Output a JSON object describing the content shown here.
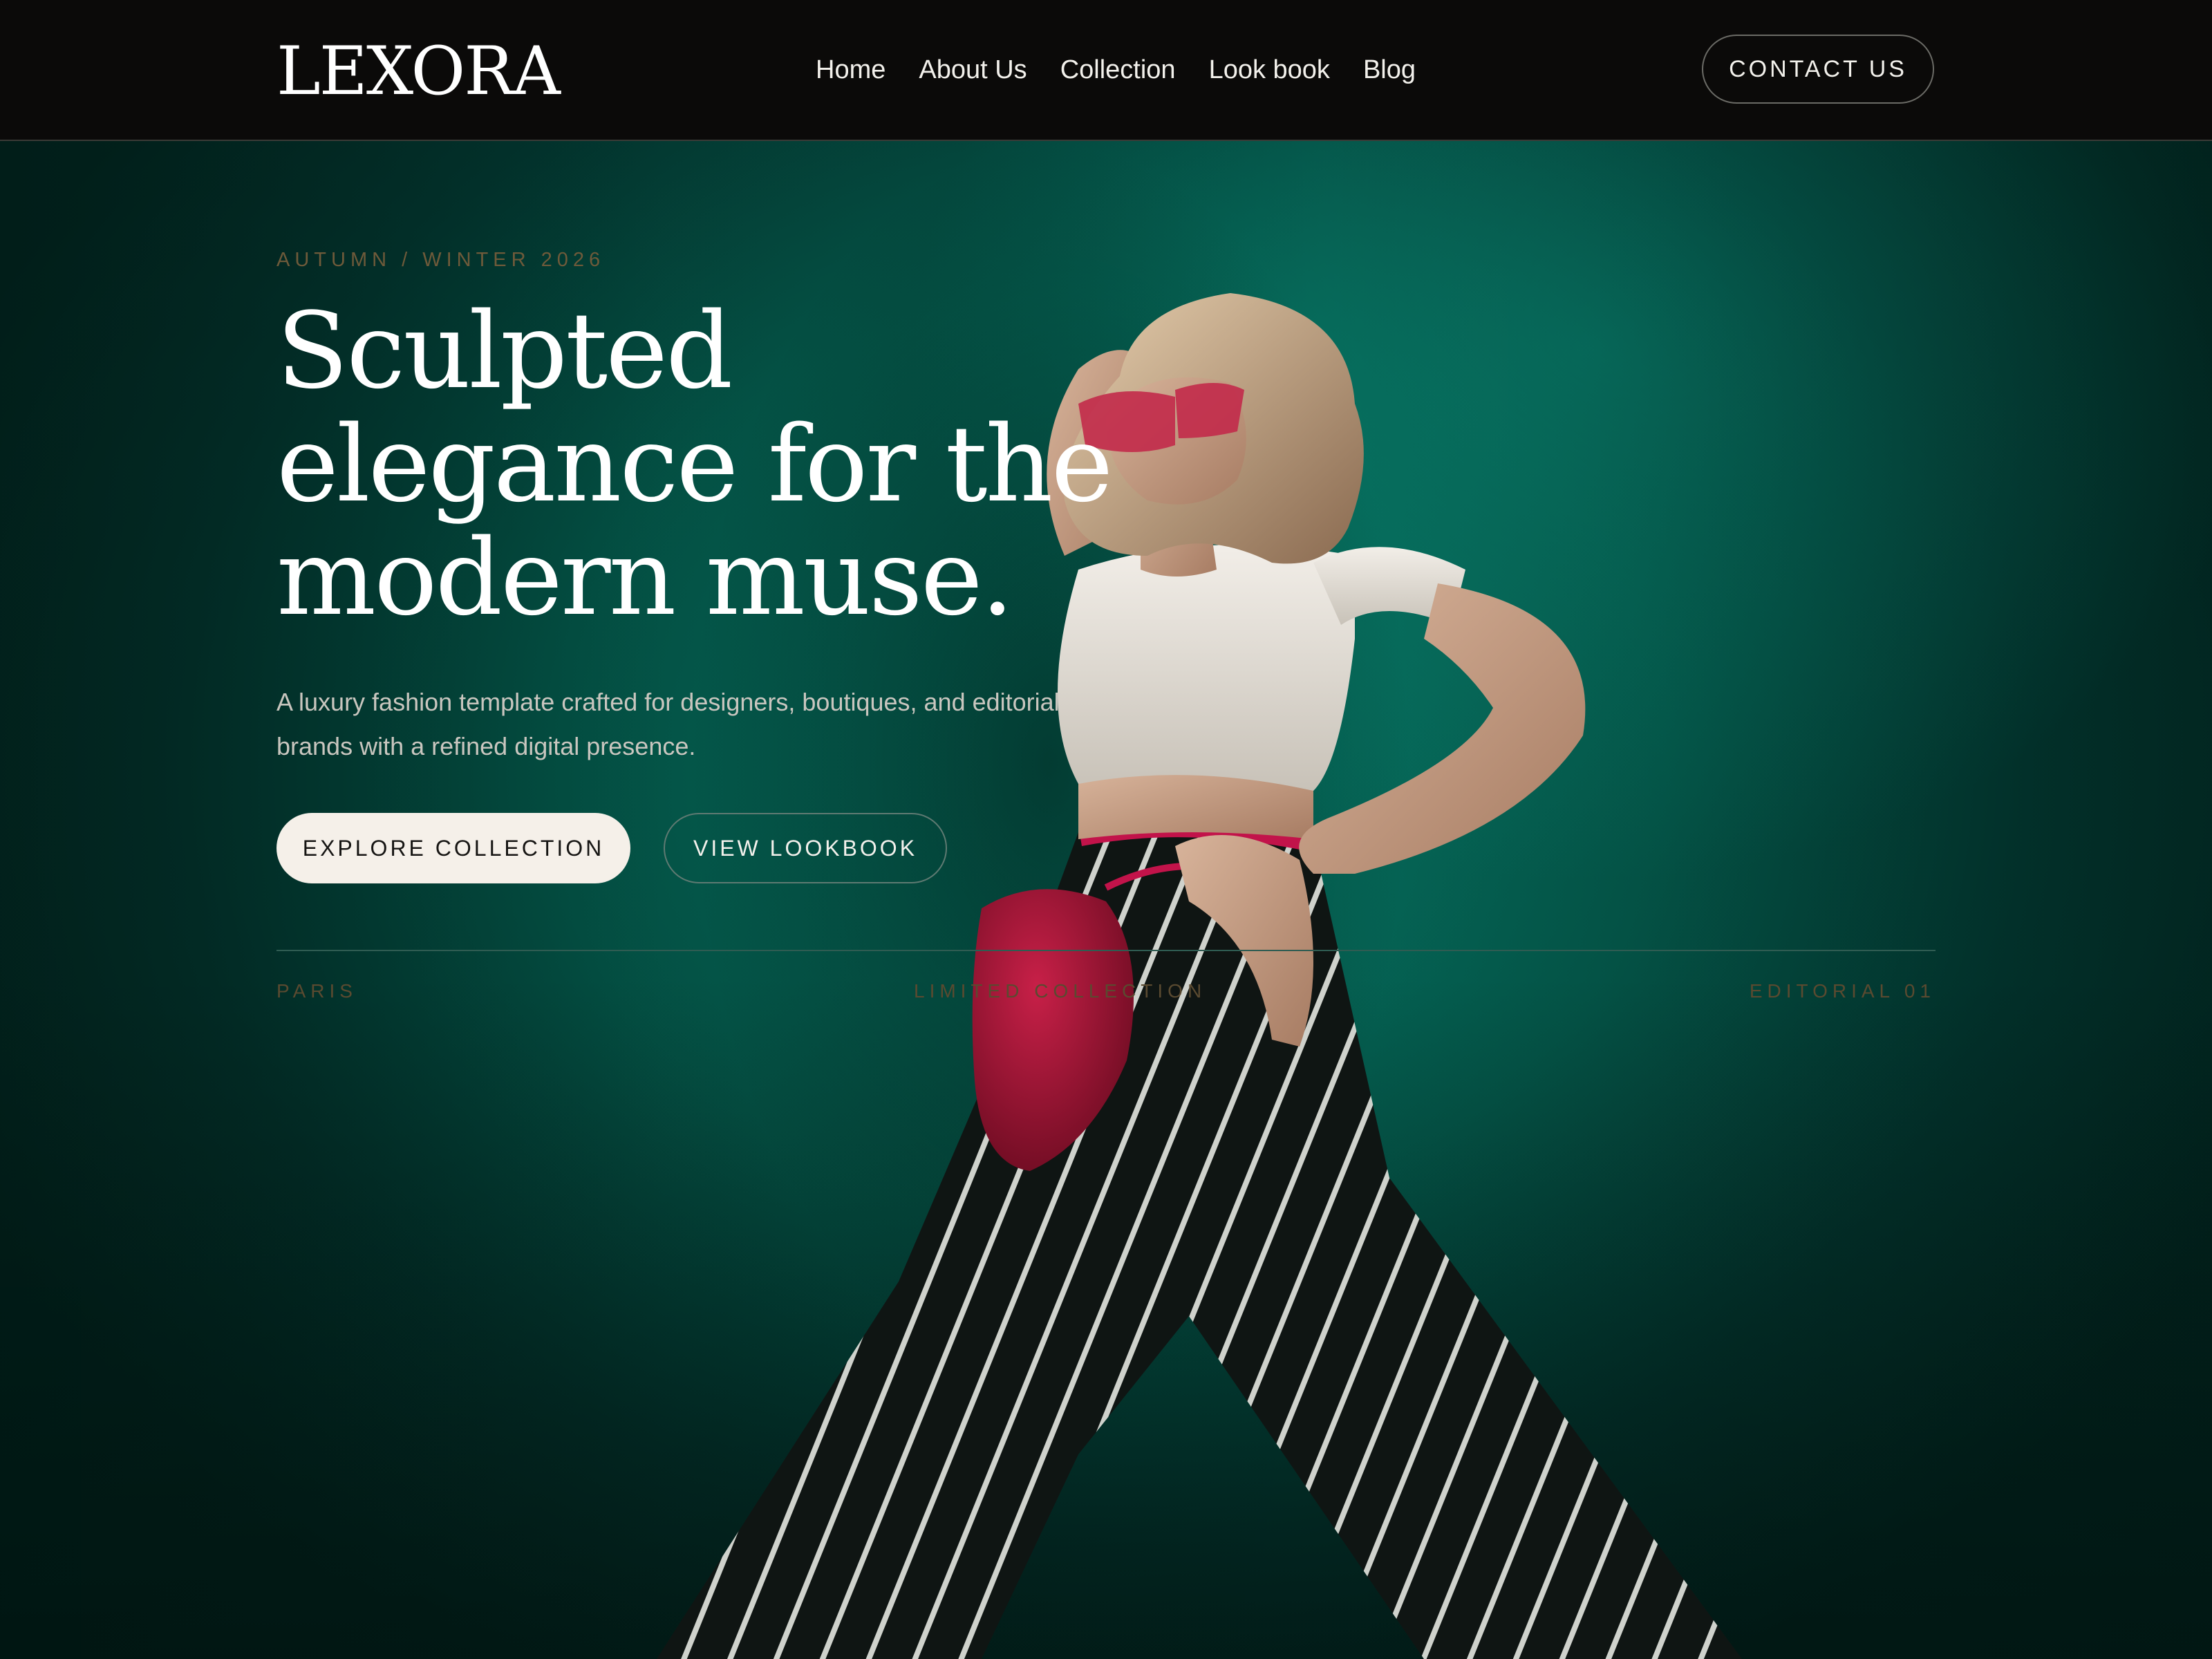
{
  "brand": {
    "logo": "LEXORA"
  },
  "nav": {
    "items": [
      "Home",
      "About Us",
      "Collection",
      "Look book",
      "Blog"
    ]
  },
  "header": {
    "contact_label": "CONTACT US"
  },
  "hero": {
    "season": "AUTUMN / WINTER 2026",
    "title_lines": [
      "Sculpted",
      "elegance for the",
      "modern muse."
    ],
    "description": "A luxury fashion template crafted for designers, boutiques, and editorial brands with a refined digital presence.",
    "primary_cta": "EXPLORE COLLECTION",
    "secondary_cta": "VIEW LOOKBOOK",
    "meta": {
      "left": "PARIS",
      "center": "LIMITED COLLECTION",
      "right": "EDITORIAL 01"
    }
  },
  "colors": {
    "header_bg": "#0b0a09",
    "hero_teal": "#067463",
    "accent_muted": "#6e5a3a",
    "button_light": "#f5f0e9"
  },
  "icons": []
}
